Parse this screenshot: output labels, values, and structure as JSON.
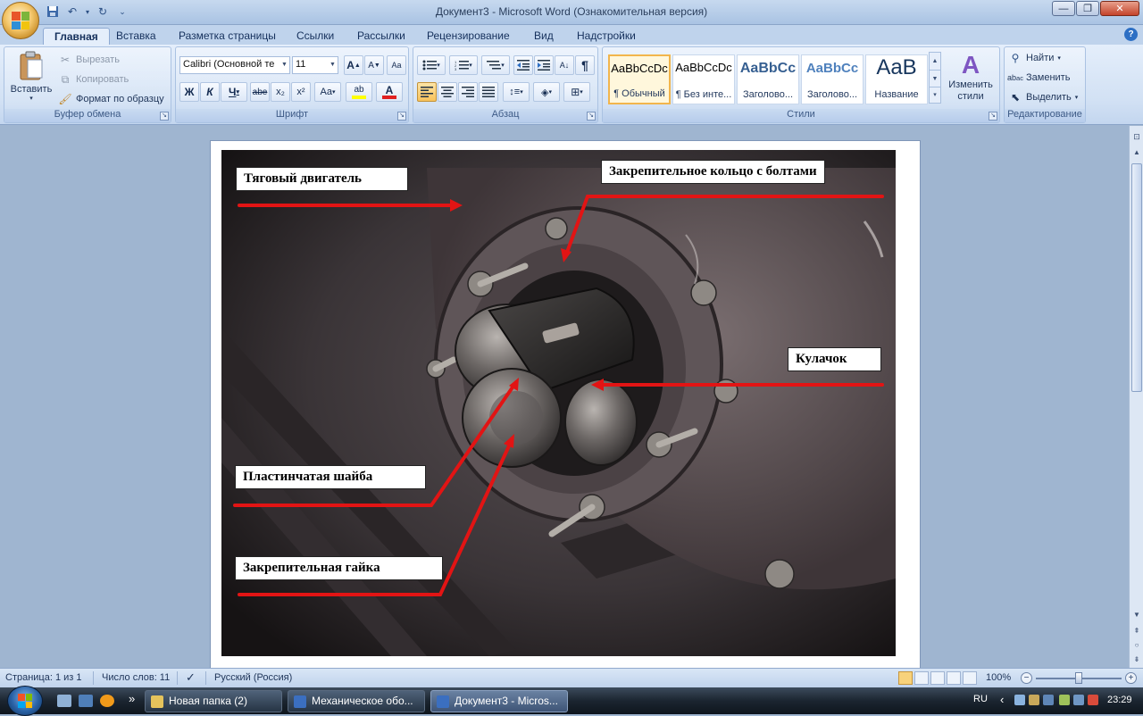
{
  "window": {
    "title": "Документ3 - Microsoft Word (Ознакомительная версия)",
    "controls": {
      "minimize": "—",
      "maximize": "❐",
      "close": "✕"
    }
  },
  "qat": [
    "save-icon",
    "undo-icon",
    "redo-icon",
    "customize-icon"
  ],
  "tabs": [
    "Главная",
    "Вставка",
    "Разметка страницы",
    "Ссылки",
    "Рассылки",
    "Рецензирование",
    "Вид",
    "Надстройки"
  ],
  "help": "?",
  "clipboard": {
    "label": "Буфер обмена",
    "paste": "Вставить",
    "cut": "Вырезать",
    "copy": "Копировать",
    "format_painter": "Формат по образцу"
  },
  "font": {
    "label": "Шрифт",
    "family": "Calibri (Основной те",
    "size": "11",
    "grow": "A",
    "shrink": "A",
    "clear": "Aa",
    "bold": "Ж",
    "italic": "К",
    "underline": "Ч",
    "strike": "abe",
    "subscript": "x₂",
    "superscript": "x²",
    "case": "Aa",
    "highlight": "ab",
    "color": "A",
    "highlight_color": "#ffff00",
    "font_color": "#e02020"
  },
  "paragraph": {
    "label": "Абзац",
    "pilcrow": "¶"
  },
  "styles": {
    "label": "Стили",
    "items": [
      {
        "sample": "AaBbCcDc",
        "name": "¶ Обычный"
      },
      {
        "sample": "AaBbCcDc",
        "name": "¶ Без инте..."
      },
      {
        "sample": "AaBbCc",
        "name": "Заголово..."
      },
      {
        "sample": "AaBbCc",
        "name": "Заголово..."
      },
      {
        "sample": "AaB",
        "name": "Название"
      }
    ],
    "change": "Изменить стили"
  },
  "editing": {
    "label": "Редактирование",
    "find": "Найти",
    "replace": "Заменить",
    "select": "Выделить"
  },
  "document": {
    "callouts": {
      "traction_motor": "Тяговый двигатель",
      "ring": "Закрепительное кольцо с болтами",
      "cam": "Кулачок",
      "washer": "Пластинчатая шайба",
      "nut": "Закрепительная гайка"
    }
  },
  "status": {
    "page": "Страница: 1 из 1",
    "words": "Число слов: 11",
    "language": "Русский (Россия)",
    "zoom": "100%",
    "zoom_minus": "−",
    "zoom_plus": "+"
  },
  "taskbar": {
    "tasks": [
      "Новая папка (2)",
      "Механическое обо...",
      "Документ3 - Micros..."
    ],
    "lang": "RU",
    "clock": "23:29",
    "expand": "»",
    "tray_arrow": "‹"
  }
}
